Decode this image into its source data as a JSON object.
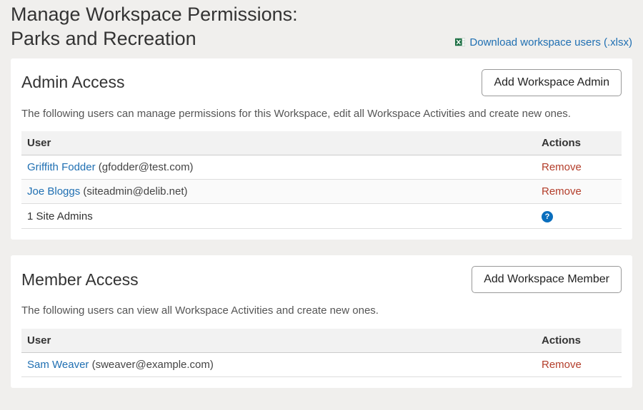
{
  "header": {
    "title_line1": "Manage Workspace Permissions:",
    "title_line2": "Parks and Recreation",
    "download_label": "Download workspace users (.xlsx)"
  },
  "admin": {
    "heading": "Admin Access",
    "add_button_label": "Add Workspace Admin",
    "description": "The following users can manage permissions for this Workspace, edit all Workspace Activities and create new ones.",
    "columns": {
      "user": "User",
      "actions": "Actions"
    },
    "rows": [
      {
        "name": "Griffith Fodder",
        "email": "(gfodder@test.com)",
        "remove": "Remove"
      },
      {
        "name": "Joe Bloggs",
        "email": "(siteadmin@delib.net)",
        "remove": "Remove"
      }
    ],
    "footer": {
      "site_admins_label": "1 Site Admins",
      "help": "?"
    }
  },
  "member": {
    "heading": "Member Access",
    "add_button_label": "Add Workspace Member",
    "description": "The following users can view all Workspace Activities and create new ones.",
    "columns": {
      "user": "User",
      "actions": "Actions"
    },
    "rows": [
      {
        "name": "Sam Weaver",
        "email": "(sweaver@example.com)",
        "remove": "Remove"
      }
    ]
  }
}
